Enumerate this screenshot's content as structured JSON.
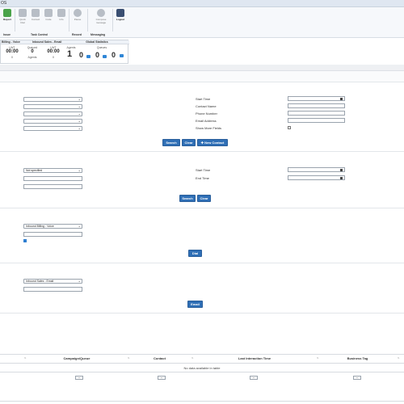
{
  "titlebar": {
    "text": "OS"
  },
  "ribbon": {
    "buttons": {
      "report": "Report",
      "quick_dial": "Quick Dial",
      "contact": "Contact",
      "code": "Code",
      "info": "Info",
      "pause": "Pause",
      "compose": "Compose message",
      "logout": "Logout"
    },
    "groups": {
      "issue": "Issue",
      "task_control": "Task Control",
      "record": "Record",
      "messaging": "Messaging"
    }
  },
  "stats": {
    "billing_voice": "Billing - Voice",
    "inbound_sales_email": "Inbound Sales - Email",
    "global_statistics": "Global Statistics",
    "lwt": "LWT",
    "queued": "Queued",
    "agents": "Agents",
    "queues": "Queues",
    "time1": "00:00",
    "queued1": "0",
    "time2": "00:00",
    "queued2": "0",
    "agents_sub1": "0",
    "agents_sub2": "0",
    "agents_global": "1",
    "q1": "0",
    "q2": "0",
    "q3": "0"
  },
  "search_contacts": {
    "start_time": "Start Time",
    "contact_name": "Contact Name",
    "phone_number": "Phone Number",
    "email_address": "Email Address",
    "show_more_fields": "Show More Fields",
    "search": "Search",
    "clear": "Clear",
    "new_contact": "New Contact"
  },
  "history": {
    "select_value": "Not specified",
    "start_time": "Start Time",
    "end_time": "End Time",
    "search": "Search",
    "clear": "Clear"
  },
  "dial": {
    "queue": "Inbound Billing - Voice",
    "dial": "Dial"
  },
  "email": {
    "queue": "Inbound Sales - Email",
    "email": "Email"
  },
  "table": {
    "columns": [
      "Campaign/Queue",
      "Contact",
      "Last Interaction Time",
      "Business Tag"
    ],
    "empty": "No data available in table"
  },
  "colors": {
    "primary": "#2f6fb6",
    "accent": "#2f86d6"
  }
}
